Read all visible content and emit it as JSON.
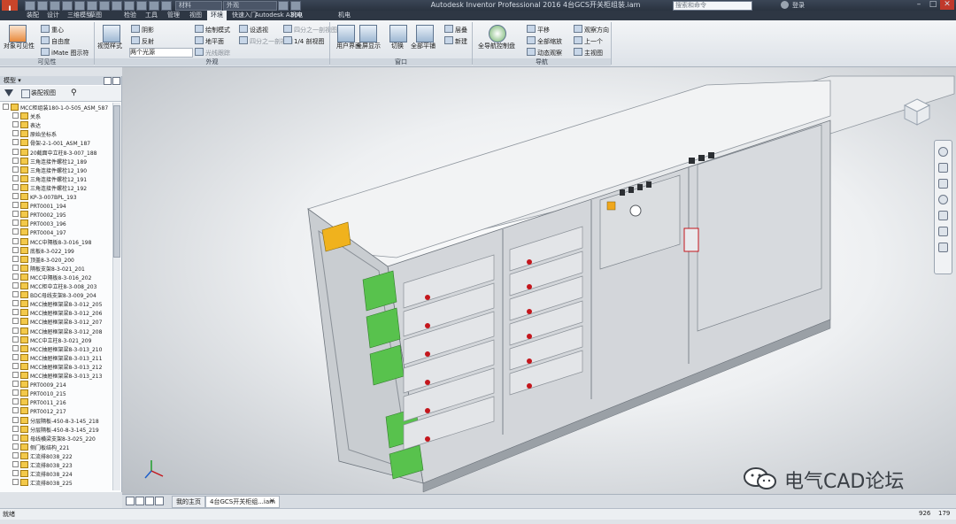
{
  "app": {
    "logo": "I PRO",
    "window_title": "Autodesk Inventor Professional 2016  4台GCS开关柜组装.iam",
    "material_select": "材料",
    "appearance_select": "外观",
    "search_placeholder": "搜索和命令",
    "user_name": "登录",
    "min": "–",
    "max": "□",
    "close": "✕"
  },
  "tabs": [
    {
      "label": "装配"
    },
    {
      "label": "设计"
    },
    {
      "label": "三维模型"
    },
    {
      "label": "草图"
    },
    {
      "label": "检验"
    },
    {
      "label": "工具"
    },
    {
      "label": "管理"
    },
    {
      "label": "视图"
    },
    {
      "label": "环境"
    },
    {
      "label": "快速入门"
    },
    {
      "label": "Autodesk A360"
    },
    {
      "label": "机电"
    }
  ],
  "ribbon": {
    "visibility": {
      "object_visibility": "对象可见性",
      "center": "重心",
      "dof": "自由度",
      "imate": "iMate 图示符",
      "panel": "可见性"
    },
    "appearance": {
      "view_style": "视觉样式",
      "shadow": "阴影",
      "reflection": "反射",
      "lighting": "两个光源",
      "shade_mode": "绘制模式",
      "ground": "地平面",
      "ray_trace": "光线跟踪",
      "perspective": "设透视",
      "half_section": "四分之一剖视图",
      "half_section2": "1/4 剖视图",
      "panel": "外观"
    },
    "window": {
      "user_interface": "用户界面",
      "fullscreen": "全屏显示",
      "switch": "切换",
      "tile": "全部平铺",
      "cascade": "层叠",
      "new": "新建",
      "panel": "窗口"
    },
    "navigate": {
      "full_nav": "全导航控制盘",
      "pan": "平移",
      "zoom_all": "全部缩放",
      "orbit": "动态观察",
      "look_at": "观察方向",
      "previous": "上一个",
      "home": "主视图",
      "panel": "导航"
    }
  },
  "browser": {
    "title": "模型 ▾",
    "toolbar_view": "装配视图",
    "tree": [
      "MCC柜组装180-1-0-505_ASM_587",
      "关系",
      "表达",
      "原始坐标系",
      "骨架-2-1-001_ASM_187",
      "20截面中立柱8-3-007_188",
      "三角连接件螺栓12_189",
      "三角连接件螺栓12_190",
      "三角连接件螺栓12_191",
      "三角连接件螺栓12_192",
      "KP-3-007BPL_193",
      "PRT0001_194",
      "PRT0002_195",
      "PRT0003_196",
      "PRT0004_197",
      "MCC中隔板8-3-016_198",
      "底板8-3-022_199",
      "顶盖8-3-020_200",
      "隔板支架8-3-021_201",
      "MCC中隔板8-3-016_202",
      "MCC柜中立柱8-3-008_203",
      "BDC母线支架8-3-009_204",
      "MCC抽屉框架梁8-3-012_205",
      "MCC抽屉框架梁8-3-012_206",
      "MCC抽屉框架梁8-3-012_207",
      "MCC抽屉框架梁8-3-012_208",
      "MCC中立柱8-3-021_209",
      "MCC抽屉框架梁8-3-013_210",
      "MCC抽屉框架梁8-3-013_211",
      "MCC抽屉框架梁8-3-013_212",
      "MCC抽屉框架梁8-3-013_213",
      "PRT0009_214",
      "PRT0010_215",
      "PRT0011_216",
      "PRT0012_217",
      "分层隔板-450-8-3-145_218",
      "分层隔板-450-8-3-145_219",
      "母线横梁支架8-3-025_220",
      "侧门板结构_221",
      "汇流排8038_222",
      "汇流排8038_223",
      "汇流排8038_224",
      "汇流排8038_225"
    ]
  },
  "doc_tabs": {
    "home": "我的主页",
    "doc": "4台GCS开关柜组...iam"
  },
  "watermark": "电气CAD论坛",
  "status": {
    "text": "就绪",
    "n1": "926",
    "n2": "179"
  }
}
